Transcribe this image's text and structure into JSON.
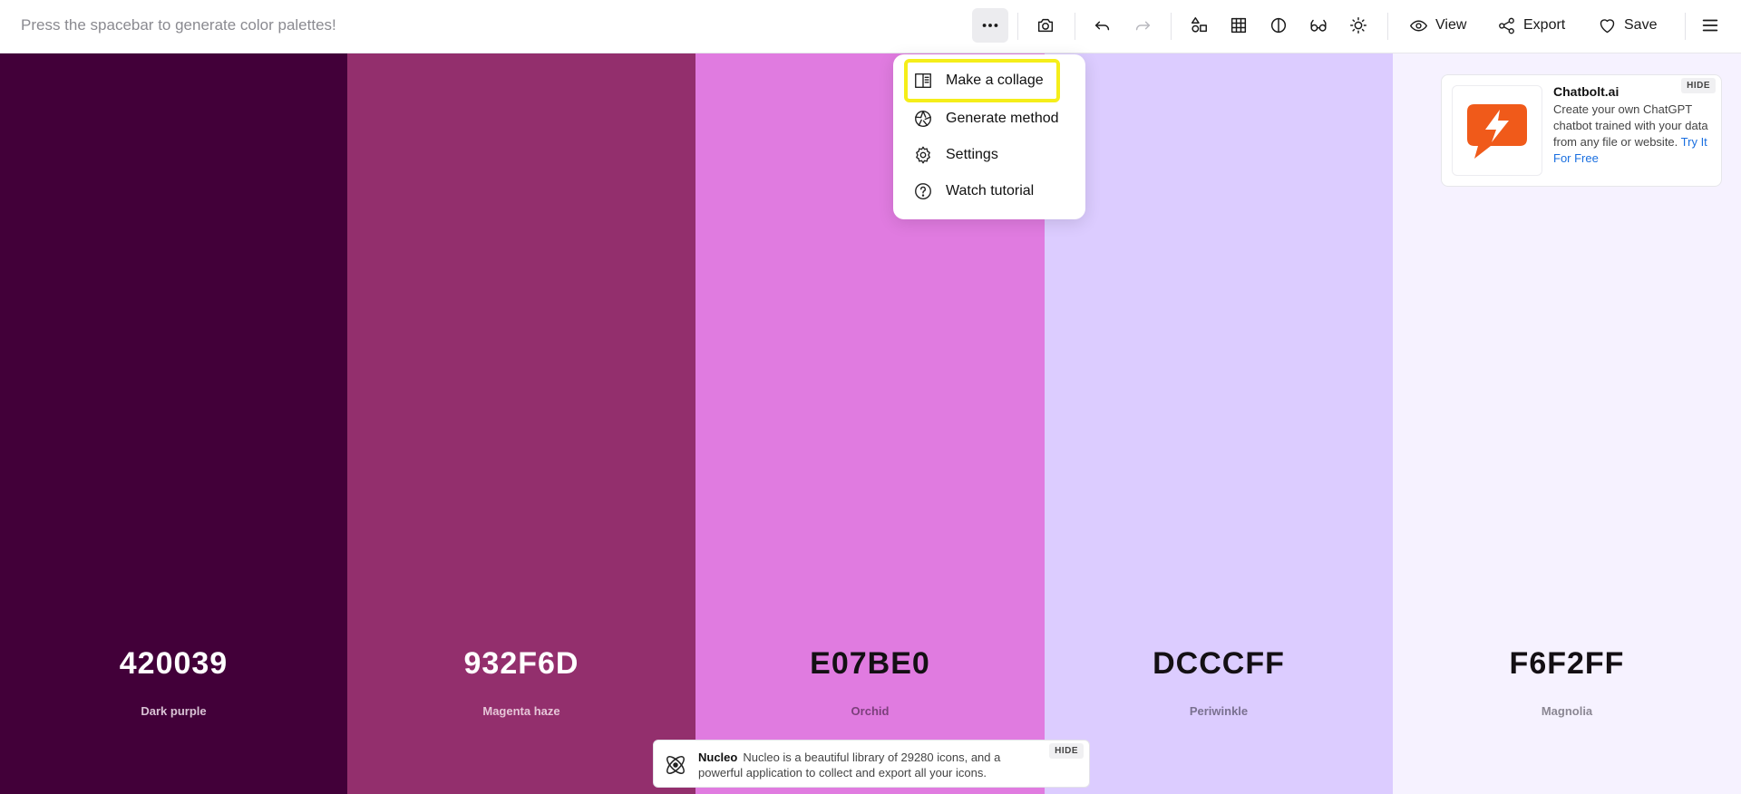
{
  "toolbar": {
    "hint": "Press the spacebar to generate color palettes!",
    "view_label": "View",
    "export_label": "Export",
    "save_label": "Save"
  },
  "colors": [
    {
      "hex": "420039",
      "name": "Dark purple",
      "bg": "#420039",
      "fg": "#ffffff",
      "name_color": "#d9c3d5"
    },
    {
      "hex": "932F6D",
      "name": "Magenta haze",
      "bg": "#932F6D",
      "fg": "#ffffff",
      "name_color": "#e6c6d8"
    },
    {
      "hex": "E07BE0",
      "name": "Orchid",
      "bg": "#E07BE0",
      "fg": "#141014",
      "name_color": "#7b3f7b"
    },
    {
      "hex": "DCCCFF",
      "name": "Periwinkle",
      "bg": "#DCCCFF",
      "fg": "#141014",
      "name_color": "#7a7190"
    },
    {
      "hex": "F6F2FF",
      "name": "Magnolia",
      "bg": "#F6F2FF",
      "fg": "#141014",
      "name_color": "#8b8793"
    }
  ],
  "menu": {
    "items": [
      {
        "label": "Make a collage",
        "icon": "collage-icon"
      },
      {
        "label": "Generate method",
        "icon": "aperture-icon"
      },
      {
        "label": "Settings",
        "icon": "gear-icon"
      },
      {
        "label": "Watch tutorial",
        "icon": "question-icon"
      }
    ],
    "highlight_color": "#f5ee1a"
  },
  "ad": {
    "title": "Chatbolt.ai",
    "body": "Create your own ChatGPT chatbot trained with your data from any file or website.",
    "link": "Try It For Free",
    "hide": "HIDE",
    "logo_color": "#f05a1a"
  },
  "bottom_ad": {
    "title": "Nucleo",
    "body": "Nucleo is a beautiful library of 29280 icons, and a powerful application to collect and export all your icons.",
    "hide": "HIDE"
  }
}
